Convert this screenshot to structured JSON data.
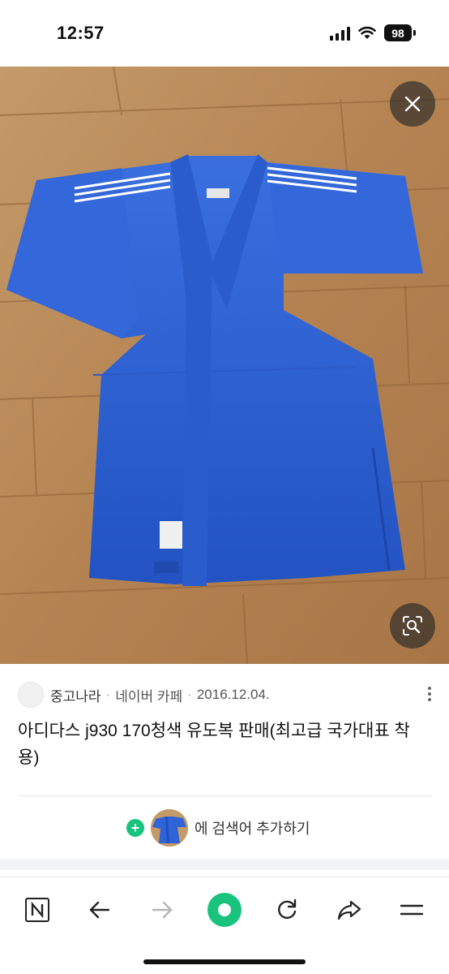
{
  "status": {
    "time": "12:57",
    "battery": "98"
  },
  "image": {
    "subject": "blue judo gi",
    "close_icon": "close-icon",
    "lens_icon": "image-search-icon"
  },
  "source": {
    "name": "중고나라",
    "platform": "네이버 카페",
    "date": "2016.12.04.",
    "separator": "·"
  },
  "title": "아디다스 j930 170청색 유도복 판매(최고급 국가대표 착용)",
  "add_search": {
    "label": "에 검색어 추가하기"
  },
  "toolbar": {
    "items": [
      "naver-home-icon",
      "back-arrow-icon",
      "forward-arrow-icon",
      "green-dot-icon",
      "refresh-icon",
      "share-icon",
      "menu-icon"
    ]
  },
  "colors": {
    "accent": "#19c37d",
    "gi_blue": "#2a5fd6",
    "floor": "#b8895a"
  }
}
